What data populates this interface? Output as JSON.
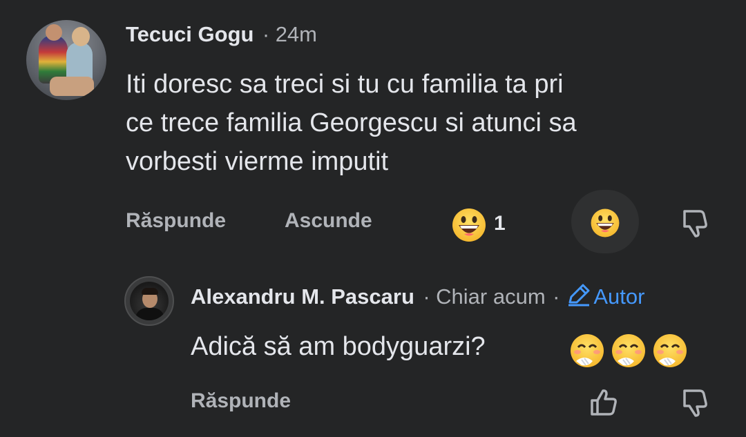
{
  "comment": {
    "author": "Tecuci Gogu",
    "separator": "·",
    "time": "24m",
    "text_lines": [
      "Iti doresc sa treci si tu cu familia ta pri",
      "ce trece familia Georgescu si atunci sa",
      "vorbesti vierme imputit"
    ],
    "reply_label": "Răspunde",
    "hide_label": "Ascunde",
    "reaction_count": "1",
    "reaction_icon": "grinning-face-emoji",
    "like_state_icon": "grinning-face-emoji",
    "dislike_icon": "thumbs-down-icon"
  },
  "reply": {
    "author": "Alexandru M. Pascaru",
    "separator1": "·",
    "time": "Chiar acum",
    "separator2": "·",
    "badge_label": "Autor",
    "badge_icon": "pencil-icon",
    "text": "Adică să am bodyguarzi?",
    "emoji_icons": [
      "face-with-hand-over-mouth-emoji",
      "face-with-hand-over-mouth-emoji",
      "face-with-hand-over-mouth-emoji"
    ],
    "reply_label": "Răspunde",
    "like_icon": "thumbs-up-icon",
    "dislike_icon": "thumbs-down-icon"
  },
  "colors": {
    "background": "#242526",
    "primary_text": "#e4e6eb",
    "secondary_text": "#b0b3b8",
    "accent": "#4599ff"
  }
}
